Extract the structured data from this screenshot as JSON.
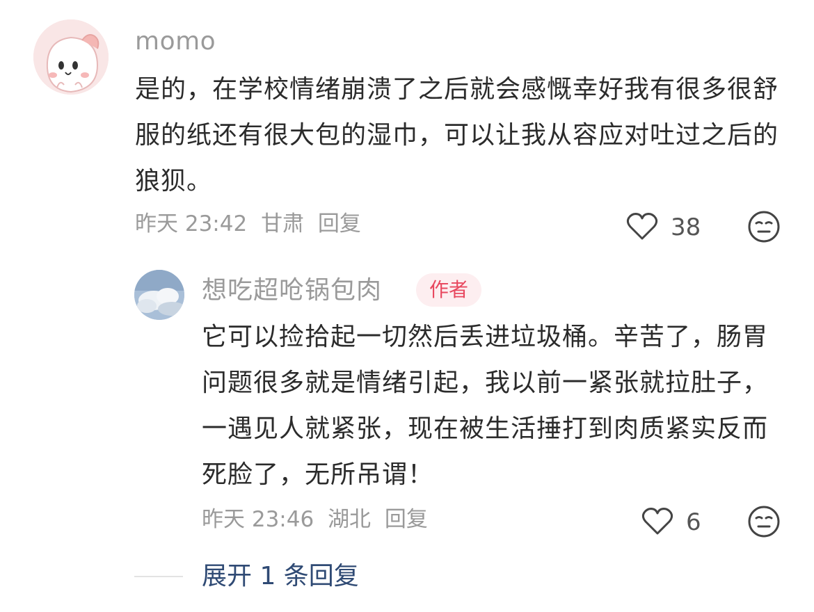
{
  "main_comment": {
    "username": "momo",
    "content": "是的，在学校情绪崩溃了之后就会感慨幸好我有很多很舒服的纸还有很大包的湿巾，可以让我从容应对吐过之后的狼狈。",
    "time": "昨天 23:42",
    "location": "甘肃",
    "reply_label": "回复",
    "like_count": "38",
    "like_icon": "heart-outline-icon",
    "dislike_icon": "meh-face-icon"
  },
  "reply": {
    "username": "想吃超呛锅包肉",
    "badge": "作者",
    "content": "它可以捡拾起一切然后丢进垃圾桶。辛苦了，肠胃问题很多就是情绪引起，我以前一紧张就拉肚子，一遇见人就紧张，现在被生活捶打到肉质紧实反而死脸了，无所吊谓！",
    "time": "昨天 23:46",
    "location": "湖北",
    "reply_label": "回复",
    "like_count": "6"
  },
  "expand": {
    "label": "展开 1 条回复"
  },
  "colors": {
    "text": "#2b2b2b",
    "meta": "#9a9a9a",
    "badge_bg": "#fdeef0",
    "badge_text": "#e8485f",
    "link": "#2f4a74"
  }
}
